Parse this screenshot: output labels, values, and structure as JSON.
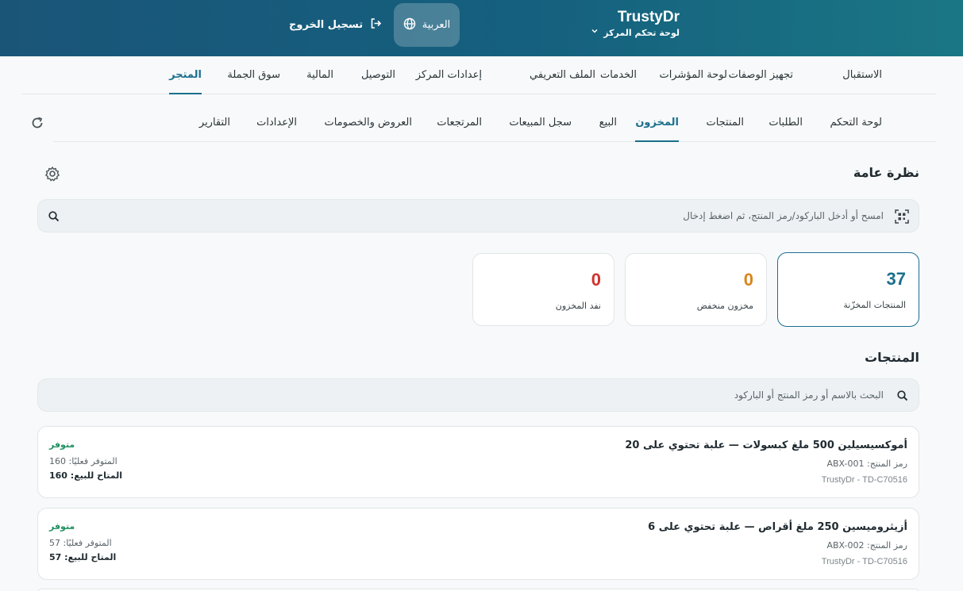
{
  "header": {
    "brand": "TrustyDr",
    "subtitle": "لوحة تحكم المركز",
    "language": "العربية",
    "logout": "تسجيل الخروج"
  },
  "main_nav": [
    {
      "label": "الاستقبال"
    },
    {
      "label": "تجهيز الوصفات"
    },
    {
      "label": "لوحة المؤشرات"
    },
    {
      "label": "الخدمات"
    },
    {
      "label": "الملف التعريفي"
    },
    {
      "label": "إعدادات المركز"
    },
    {
      "label": "التوصيل"
    },
    {
      "label": "المالية"
    },
    {
      "label": "سوق الجملة"
    },
    {
      "label": "المتجر",
      "active": true
    }
  ],
  "sub_nav": [
    {
      "label": "لوحة التحكم"
    },
    {
      "label": "الطلبات"
    },
    {
      "label": "المنتجات"
    },
    {
      "label": "المخزون",
      "active": true
    },
    {
      "label": "البيع"
    },
    {
      "label": "سجل المبيعات"
    },
    {
      "label": "المرتجعات"
    },
    {
      "label": "العروض والخصومات"
    },
    {
      "label": "الإعدادات"
    },
    {
      "label": "التقارير"
    }
  ],
  "overview": {
    "title": "نظرة عامة",
    "scan_placeholder": "امسح أو أدخل الباركود/رمز المنتج، ثم اضغط إدخال"
  },
  "stats": [
    {
      "value": "37",
      "label": "المنتجات المخزّنة",
      "color": "#1c6f8c"
    },
    {
      "value": "0",
      "label": "مخزون منخفض",
      "color": "#d9841a"
    },
    {
      "value": "0",
      "label": "نفد المخزون",
      "color": "#d0312d"
    }
  ],
  "products": {
    "title": "المنتجات",
    "search_placeholder": "البحث بالاسم أو رمز المنتج أو الباركود",
    "items": [
      {
        "name": "أموكسيسيلين 500 ملغ كبسولات — علبة تحتوي على 20",
        "code": "رمز المنتج: ABX-001",
        "center": "TrustyDr - TD-C70516",
        "status": "متوفر",
        "actual": "المتوفر فعليًا: 160",
        "available": "المتاح للبيع: 160"
      },
      {
        "name": "أزيثروميسين 250 ملغ أقراص — علبة تحتوي على 6",
        "code": "رمز المنتج: ABX-002",
        "center": "TrustyDr - TD-C70516",
        "status": "متوفر",
        "actual": "المتوفر فعليًا: 57",
        "available": "المتاح للبيع: 57"
      }
    ]
  }
}
